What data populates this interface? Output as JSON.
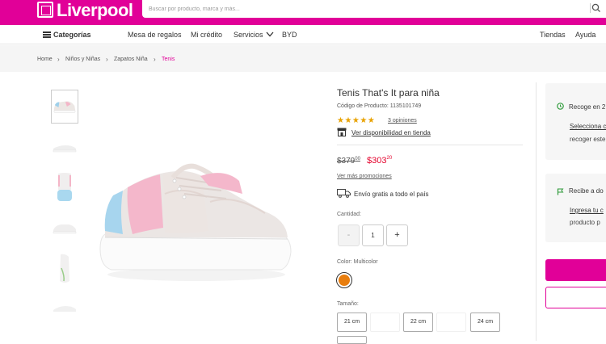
{
  "brand": {
    "logo_text": "Liverpool",
    "accent": "#e10098"
  },
  "search": {
    "placeholder": "Buscar por producto, marca y más..."
  },
  "nav": {
    "categories": "Categorías",
    "items": [
      "Mesa de regalos",
      "Mi crédito",
      "Servicios",
      "BYD"
    ],
    "right": [
      "Tiendas",
      "Ayuda"
    ]
  },
  "breadcrumb": [
    "Home",
    "Niños y Niñas",
    "Zapatos Niña",
    "Tenis"
  ],
  "product": {
    "title": "Tenis That's It para niña",
    "code": "Código de Producto: 1135101749",
    "rating": "★★★★★",
    "rating_value": 4.5,
    "reviews": "3 opiniones",
    "availability": "Ver disponibilidad en tienda",
    "old_price_int": "$379",
    "old_price_dec": "00",
    "new_price_int": "$303",
    "new_price_dec": "20",
    "promos": "Ver más promociones",
    "shipping": "Envío gratis a todo el país",
    "qty_label": "Cantidad:",
    "qty_minus": "-",
    "qty_value": "1",
    "qty_plus": "+",
    "color_label": "Color: Multicolor",
    "color_swatch": "#e87d0d",
    "size_label": "Tamaño:",
    "sizes": [
      "21 cm",
      "",
      "22 cm",
      "",
      "24 cm"
    ]
  },
  "side": {
    "pickup_title": "Recoge en 2",
    "pickup_link": "Selecciona c",
    "pickup_text": "recoger este",
    "delivery_title": "Recibe a do",
    "delivery_link": "Ingresa tu c",
    "delivery_text": "producto p"
  },
  "colors": {
    "price_red": "#e4002b",
    "star": "#e8a200",
    "icon_green": "#2e9b3a"
  }
}
